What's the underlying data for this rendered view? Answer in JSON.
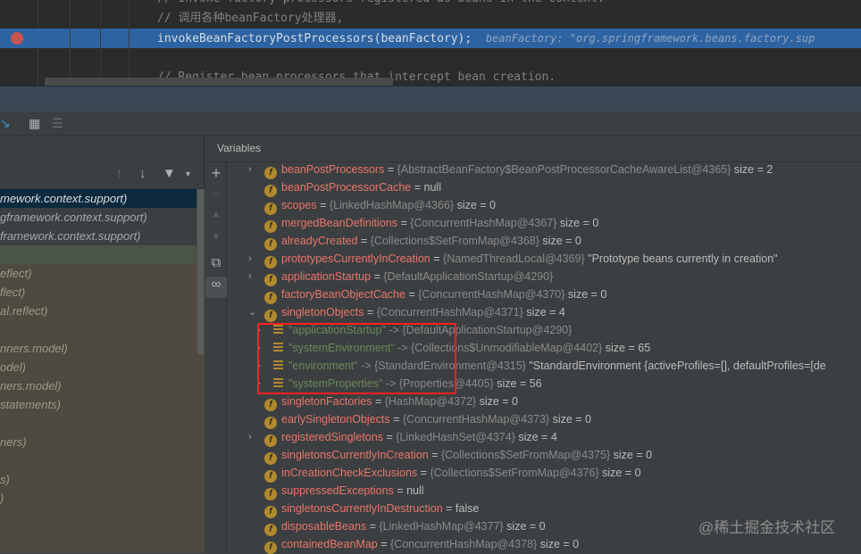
{
  "editor": {
    "lines": [
      {
        "text": "// Invoke factory processors registered as beans in the context.",
        "kind": "comment"
      },
      {
        "text": "// 调用各种beanFactory处理器,",
        "kind": "comment"
      },
      {
        "text": "invokeBeanFactoryPostProcessors(beanFactory);",
        "kind": "code"
      },
      {
        "text": "",
        "kind": "code"
      },
      {
        "text": "// Register bean processors that intercept bean creation.",
        "kind": "comment"
      }
    ],
    "inline_hint": "beanFactory: \"org.springframework.beans.factory.sup",
    "highlight_color": "#2e63a2"
  },
  "frames": {
    "items": [
      "mework.context.support)",
      "gframework.context.support)",
      "framework.context.support)",
      "",
      "eflect)",
      "flect)",
      "al.reflect)",
      "",
      "nners.model)",
      "odel)",
      "ners.model)",
      "statements)",
      "",
      "ners)",
      "",
      "s)",
      ")"
    ]
  },
  "variables": {
    "title": "Variables",
    "rows": [
      {
        "exp": "collapsed",
        "icon": "field",
        "name": "beanPostProcessors",
        "val": "{AbstractBeanFactory$BeanPostProcessorCacheAwareList@4365}",
        "extra": "size = 2"
      },
      {
        "exp": "",
        "icon": "field",
        "name": "beanPostProcessorCache",
        "val": "",
        "extra": "null"
      },
      {
        "exp": "",
        "icon": "field",
        "name": "scopes",
        "val": "{LinkedHashMap@4366}",
        "extra": "size = 0"
      },
      {
        "exp": "",
        "icon": "field",
        "name": "mergedBeanDefinitions",
        "val": "{ConcurrentHashMap@4367}",
        "extra": "size = 0"
      },
      {
        "exp": "",
        "icon": "field",
        "name": "alreadyCreated",
        "val": "{Collections$SetFromMap@4368}",
        "extra": "size = 0"
      },
      {
        "exp": "collapsed",
        "icon": "field",
        "name": "prototypesCurrentlyInCreation",
        "val": "{NamedThreadLocal@4369}",
        "extra": "\"Prototype beans currently in creation\""
      },
      {
        "exp": "collapsed",
        "icon": "field",
        "name": "applicationStartup",
        "val": "{DefaultApplicationStartup@4290}",
        "extra": ""
      },
      {
        "exp": "",
        "icon": "field",
        "name": "factoryBeanObjectCache",
        "val": "{ConcurrentHashMap@4370}",
        "extra": "size = 0"
      },
      {
        "exp": "expanded",
        "icon": "field",
        "name": "singletonObjects",
        "val": "{ConcurrentHashMap@4371}",
        "extra": "size = 4"
      },
      {
        "exp": "collapsed",
        "icon": "map",
        "key": "\"applicationStartup\"",
        "val": "{DefaultApplicationStartup@4290}",
        "extra": ""
      },
      {
        "exp": "collapsed",
        "icon": "map",
        "key": "\"systemEnvironment\"",
        "val": "{Collections$UnmodifiableMap@4402}",
        "extra": "size = 65"
      },
      {
        "exp": "collapsed",
        "icon": "map",
        "key": "\"environment\"",
        "val": "{StandardEnvironment@4315}",
        "extra": "\"StandardEnvironment {activeProfiles=[], defaultProfiles=[de"
      },
      {
        "exp": "collapsed",
        "icon": "map",
        "key": "\"systemProperties\"",
        "val": "{Properties@4405}",
        "extra": "size = 56"
      },
      {
        "exp": "",
        "icon": "field",
        "name": "singletonFactories",
        "val": "{HashMap@4372}",
        "extra": "size = 0"
      },
      {
        "exp": "",
        "icon": "field",
        "name": "earlySingletonObjects",
        "val": "{ConcurrentHashMap@4373}",
        "extra": "size = 0"
      },
      {
        "exp": "collapsed",
        "icon": "field",
        "name": "registeredSingletons",
        "val": "{LinkedHashSet@4374}",
        "extra": "size = 4"
      },
      {
        "exp": "",
        "icon": "field",
        "name": "singletonsCurrentlyInCreation",
        "val": "{Collections$SetFromMap@4375}",
        "extra": "size = 0"
      },
      {
        "exp": "",
        "icon": "field",
        "name": "inCreationCheckExclusions",
        "val": "{Collections$SetFromMap@4376}",
        "extra": "size = 0"
      },
      {
        "exp": "",
        "icon": "field",
        "name": "suppressedExceptions",
        "val": "",
        "extra": "null"
      },
      {
        "exp": "",
        "icon": "field",
        "name": "singletonsCurrentlyInDestruction",
        "val": "",
        "extra": "false"
      },
      {
        "exp": "",
        "icon": "field",
        "name": "disposableBeans",
        "val": "{LinkedHashMap@4377}",
        "extra": "size = 0"
      },
      {
        "exp": "",
        "icon": "field",
        "name": "containedBeanMap",
        "val": "{ConcurrentHashMap@4378}",
        "extra": "size = 0"
      }
    ]
  },
  "watermark": "@稀土掘金技术社区",
  "colors": {
    "field_name": "#e8756a",
    "map_key": "#6a8759",
    "annotation_box": "#ff2020"
  }
}
